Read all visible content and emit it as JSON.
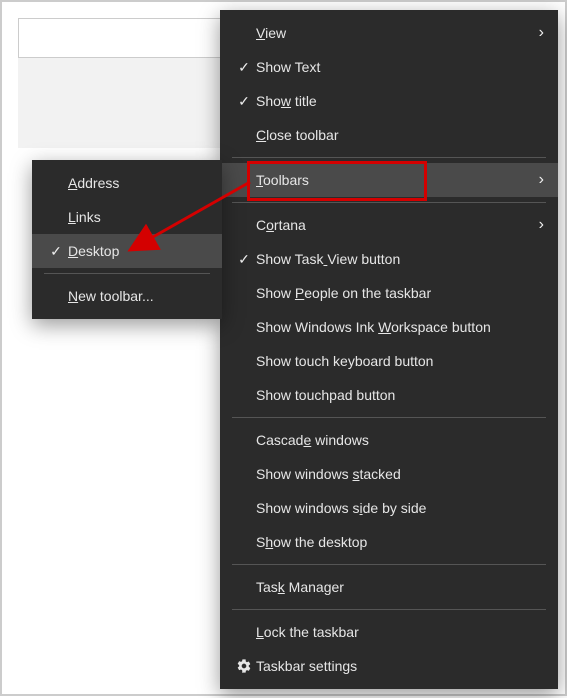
{
  "main_menu": {
    "groups": [
      [
        {
          "id": "view",
          "label": "View",
          "underline": 0,
          "checked": false,
          "submenu": true
        },
        {
          "id": "show-text",
          "label": "Show Text",
          "underline": -1,
          "checked": true,
          "submenu": false
        },
        {
          "id": "show-title",
          "label": "Show title",
          "underline": 3,
          "checked": true,
          "submenu": false
        },
        {
          "id": "close-toolbar",
          "label": "Close toolbar",
          "underline": 0,
          "checked": false,
          "submenu": false
        }
      ],
      [
        {
          "id": "toolbars",
          "label": "Toolbars",
          "underline": 0,
          "checked": false,
          "submenu": true,
          "hover": true,
          "highlight": true
        }
      ],
      [
        {
          "id": "cortana",
          "label": "Cortana",
          "underline": 1,
          "checked": false,
          "submenu": true
        },
        {
          "id": "task-view-btn",
          "label": "Show Task View button",
          "underline": 9,
          "checked": true,
          "submenu": false
        },
        {
          "id": "people",
          "label": "Show People on the taskbar",
          "underline": 5,
          "checked": false,
          "submenu": false
        },
        {
          "id": "ink-workspace",
          "label": "Show Windows Ink Workspace button",
          "underline": 17,
          "checked": false,
          "submenu": false
        },
        {
          "id": "touch-keyboard",
          "label": "Show touch keyboard button",
          "underline": -1,
          "checked": false,
          "submenu": false
        },
        {
          "id": "touchpad",
          "label": "Show touchpad button",
          "underline": -1,
          "checked": false,
          "submenu": false
        }
      ],
      [
        {
          "id": "cascade",
          "label": "Cascade windows",
          "underline": 6,
          "checked": false,
          "submenu": false
        },
        {
          "id": "stacked",
          "label": "Show windows stacked",
          "underline": 13,
          "checked": false,
          "submenu": false
        },
        {
          "id": "side-by-side",
          "label": "Show windows side by side",
          "underline": 14,
          "checked": false,
          "submenu": false
        },
        {
          "id": "show-desktop",
          "label": "Show the desktop",
          "underline": 1,
          "checked": false,
          "submenu": false
        }
      ],
      [
        {
          "id": "task-manager",
          "label": "Task Manager",
          "underline": 3,
          "checked": false,
          "submenu": false
        }
      ],
      [
        {
          "id": "lock-taskbar",
          "label": "Lock the taskbar",
          "underline": 0,
          "checked": false,
          "submenu": false
        },
        {
          "id": "taskbar-settings",
          "label": "Taskbar settings",
          "underline": -1,
          "checked": false,
          "submenu": false,
          "icon": "gear"
        }
      ]
    ]
  },
  "sub_menu": {
    "groups": [
      [
        {
          "id": "address",
          "label": "Address",
          "underline": 0,
          "checked": false
        },
        {
          "id": "links",
          "label": "Links",
          "underline": 0,
          "checked": false
        },
        {
          "id": "desktop",
          "label": "Desktop",
          "underline": 0,
          "checked": true,
          "hover": true
        }
      ],
      [
        {
          "id": "new-toolbar",
          "label": "New toolbar...",
          "underline": 0,
          "checked": false
        }
      ]
    ]
  },
  "colors": {
    "menu_bg": "#2b2b2b",
    "menu_fg": "#e6e6e6",
    "hover_bg": "#4a4a4a",
    "highlight": "#d40000"
  }
}
